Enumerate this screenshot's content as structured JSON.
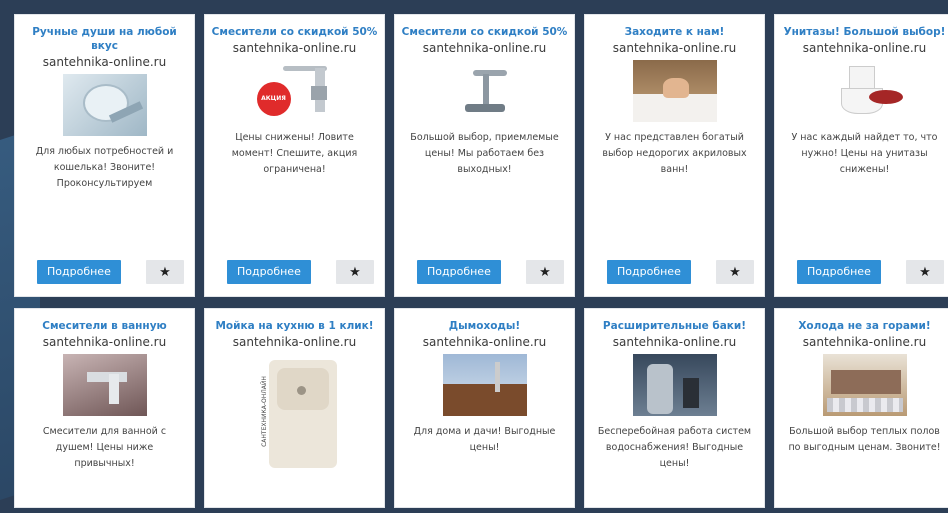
{
  "ads": [
    {
      "title": "Ручные души на любой вкус",
      "domain": "santehnika-online.ru",
      "image": "shower-heads",
      "desc": "Для любых потребностей и кошелька! Звоните! Проконсультируем",
      "more": "Подробнее",
      "fav": "★"
    },
    {
      "title": "Смесители со скидкой 50%",
      "domain": "santehnika-online.ru",
      "image": "faucet-sale",
      "badge": "АКЦИЯ",
      "desc": "Цены снижены! Ловите момент! Спешите, акция ограничена!",
      "more": "Подробнее",
      "fav": "★"
    },
    {
      "title": "Смесители со скидкой 50%",
      "domain": "santehnika-online.ru",
      "image": "faucet",
      "desc": "Большой выбор, приемлемые цены! Мы работаем без выходных!",
      "more": "Подробнее",
      "fav": "★"
    },
    {
      "title": "Заходите к нам!",
      "domain": "santehnika-online.ru",
      "image": "bathtub",
      "desc": "У нас представлен богатый выбор недорогих акриловых ванн!",
      "more": "Подробнее",
      "fav": "★"
    },
    {
      "title": "Унитазы! Большой выбор!",
      "domain": "santehnika-online.ru",
      "image": "toilet",
      "desc": "У нас каждый найдет то, что нужно! Цены на унитазы снижены!",
      "more": "Подробнее",
      "fav": "★"
    },
    {
      "title": "Смесители в ванную",
      "domain": "santehnika-online.ru",
      "image": "bath-mixer",
      "desc": "Смесители для ванной с душем! Цены ниже привычных!"
    },
    {
      "title": "Мойка на кухню в 1 клик!",
      "domain": "santehnika-online.ru",
      "image": "kitchen-sink",
      "vertical": "САНТЕХНИКА-ОНЛАЙН",
      "desc": ""
    },
    {
      "title": "Дымоходы!",
      "domain": "santehnika-online.ru",
      "image": "chimney",
      "desc": "Для дома и дачи! Выгодные цены!"
    },
    {
      "title": "Расширительные баки!",
      "domain": "santehnika-online.ru",
      "image": "expansion-tank",
      "desc": "Бесперебойная работа систем водоснабжения! Выгодные цены!"
    },
    {
      "title": "Холода не за горами!",
      "domain": "santehnika-online.ru",
      "image": "warm-floor",
      "desc": "Большой выбор теплых полов по выгодным ценам. Звоните!"
    }
  ]
}
